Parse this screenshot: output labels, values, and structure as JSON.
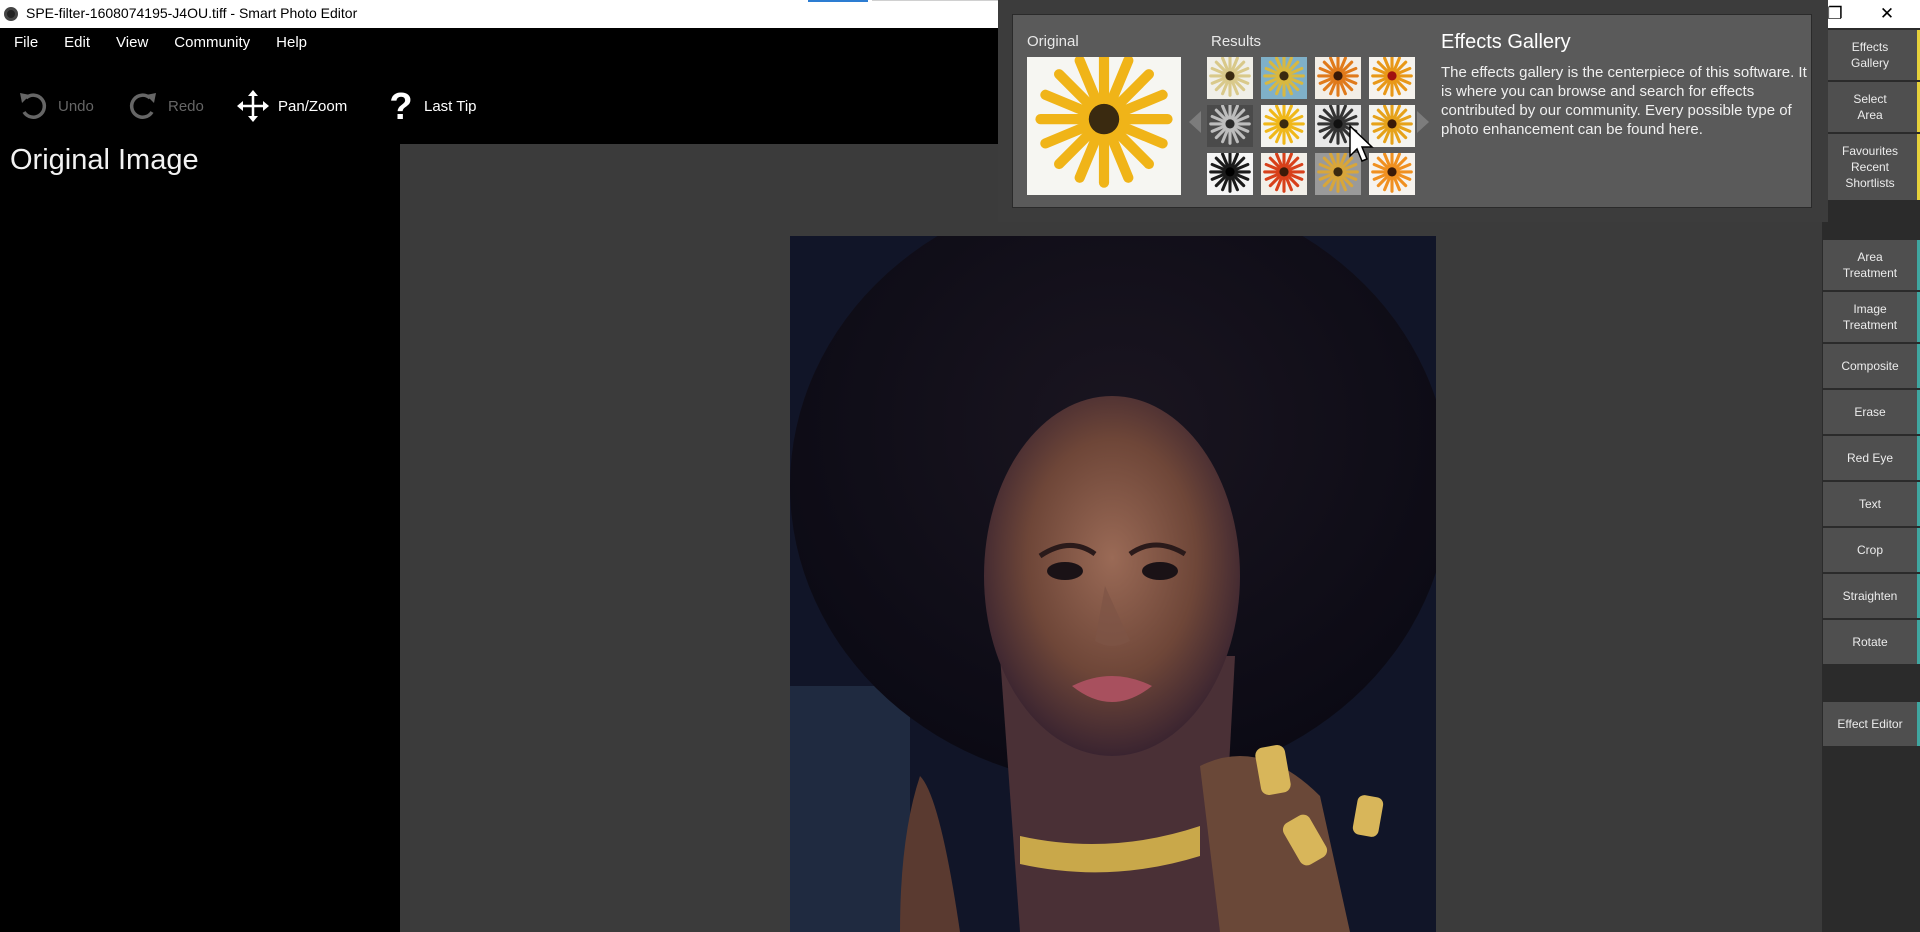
{
  "window": {
    "title": "SPE-filter-1608074195-J4OU.tiff - Smart Photo Editor",
    "restore_glyph": "❐",
    "close_glyph": "✕"
  },
  "menu": [
    "File",
    "Edit",
    "View",
    "Community",
    "Help"
  ],
  "toolbar": {
    "undo": "Undo",
    "redo": "Redo",
    "pan_zoom": "Pan/Zoom",
    "last_tip": "Last Tip"
  },
  "left_panel": {
    "title": "Original Image"
  },
  "sidebar": {
    "buttons": [
      {
        "label": "Effects\nGallery",
        "accent": "#e6d13a"
      },
      {
        "label": "Select\nArea",
        "accent": "#e6d13a"
      },
      {
        "label": "Favourites\nRecent\nShortlists",
        "accent": "#e6d13a"
      },
      {
        "label": "Area\nTreatment",
        "accent": "#3fa6a0"
      },
      {
        "label": "Image\nTreatment",
        "accent": "#3fa6a0"
      },
      {
        "label": "Composite",
        "accent": "#3fa6a0"
      },
      {
        "label": "Erase",
        "accent": "#3fa6a0"
      },
      {
        "label": "Red Eye",
        "accent": "#3fa6a0"
      },
      {
        "label": "Text",
        "accent": "#3fa6a0"
      },
      {
        "label": "Crop",
        "accent": "#3fa6a0"
      },
      {
        "label": "Straighten",
        "accent": "#3fa6a0"
      },
      {
        "label": "Rotate",
        "accent": "#3fa6a0"
      },
      {
        "label": "Effect Editor",
        "accent": "#3fa6a0"
      }
    ]
  },
  "gallery_tip": {
    "original_label": "Original",
    "results_label": "Results",
    "heading": "Effects Gallery",
    "description": "The effects gallery is the centerpiece of this software. It is where you can browse and search for effects contributed by our community.  Every possible type of photo enhancement can be found here.",
    "thumbnails": [
      {
        "petal": "#d9c98a",
        "bg": "#f0efe8",
        "center": "#3a2a10"
      },
      {
        "petal": "#d8b840",
        "bg": "#7fb0c8",
        "center": "#3a2a10"
      },
      {
        "petal": "#e07a1a",
        "bg": "#f3eee6",
        "center": "#3a1a08"
      },
      {
        "petal": "#e89818",
        "bg": "#f6f3ee",
        "center": "#a01010"
      },
      {
        "petal": "#bdbdbd",
        "bg": "#4a4a4a",
        "center": "#2a2a2a"
      },
      {
        "petal": "#f0b81a",
        "bg": "#f4f4f0",
        "center": "#3a2a10"
      },
      {
        "petal": "#333333",
        "bg": "#e8e8e8",
        "center": "#111111"
      },
      {
        "petal": "#e6a21a",
        "bg": "#f4f4f0",
        "center": "#3a1a08"
      },
      {
        "petal": "#1a1a1a",
        "bg": "#f4f4f4",
        "center": "#000000"
      },
      {
        "petal": "#d8401a",
        "bg": "#f2efe8",
        "center": "#3a1a08"
      },
      {
        "petal": "#d8a63a",
        "bg": "#9a9a9a",
        "center": "#3a2a10"
      },
      {
        "petal": "#f09020",
        "bg": "#f6f3ee",
        "center": "#3a1a08"
      }
    ]
  }
}
